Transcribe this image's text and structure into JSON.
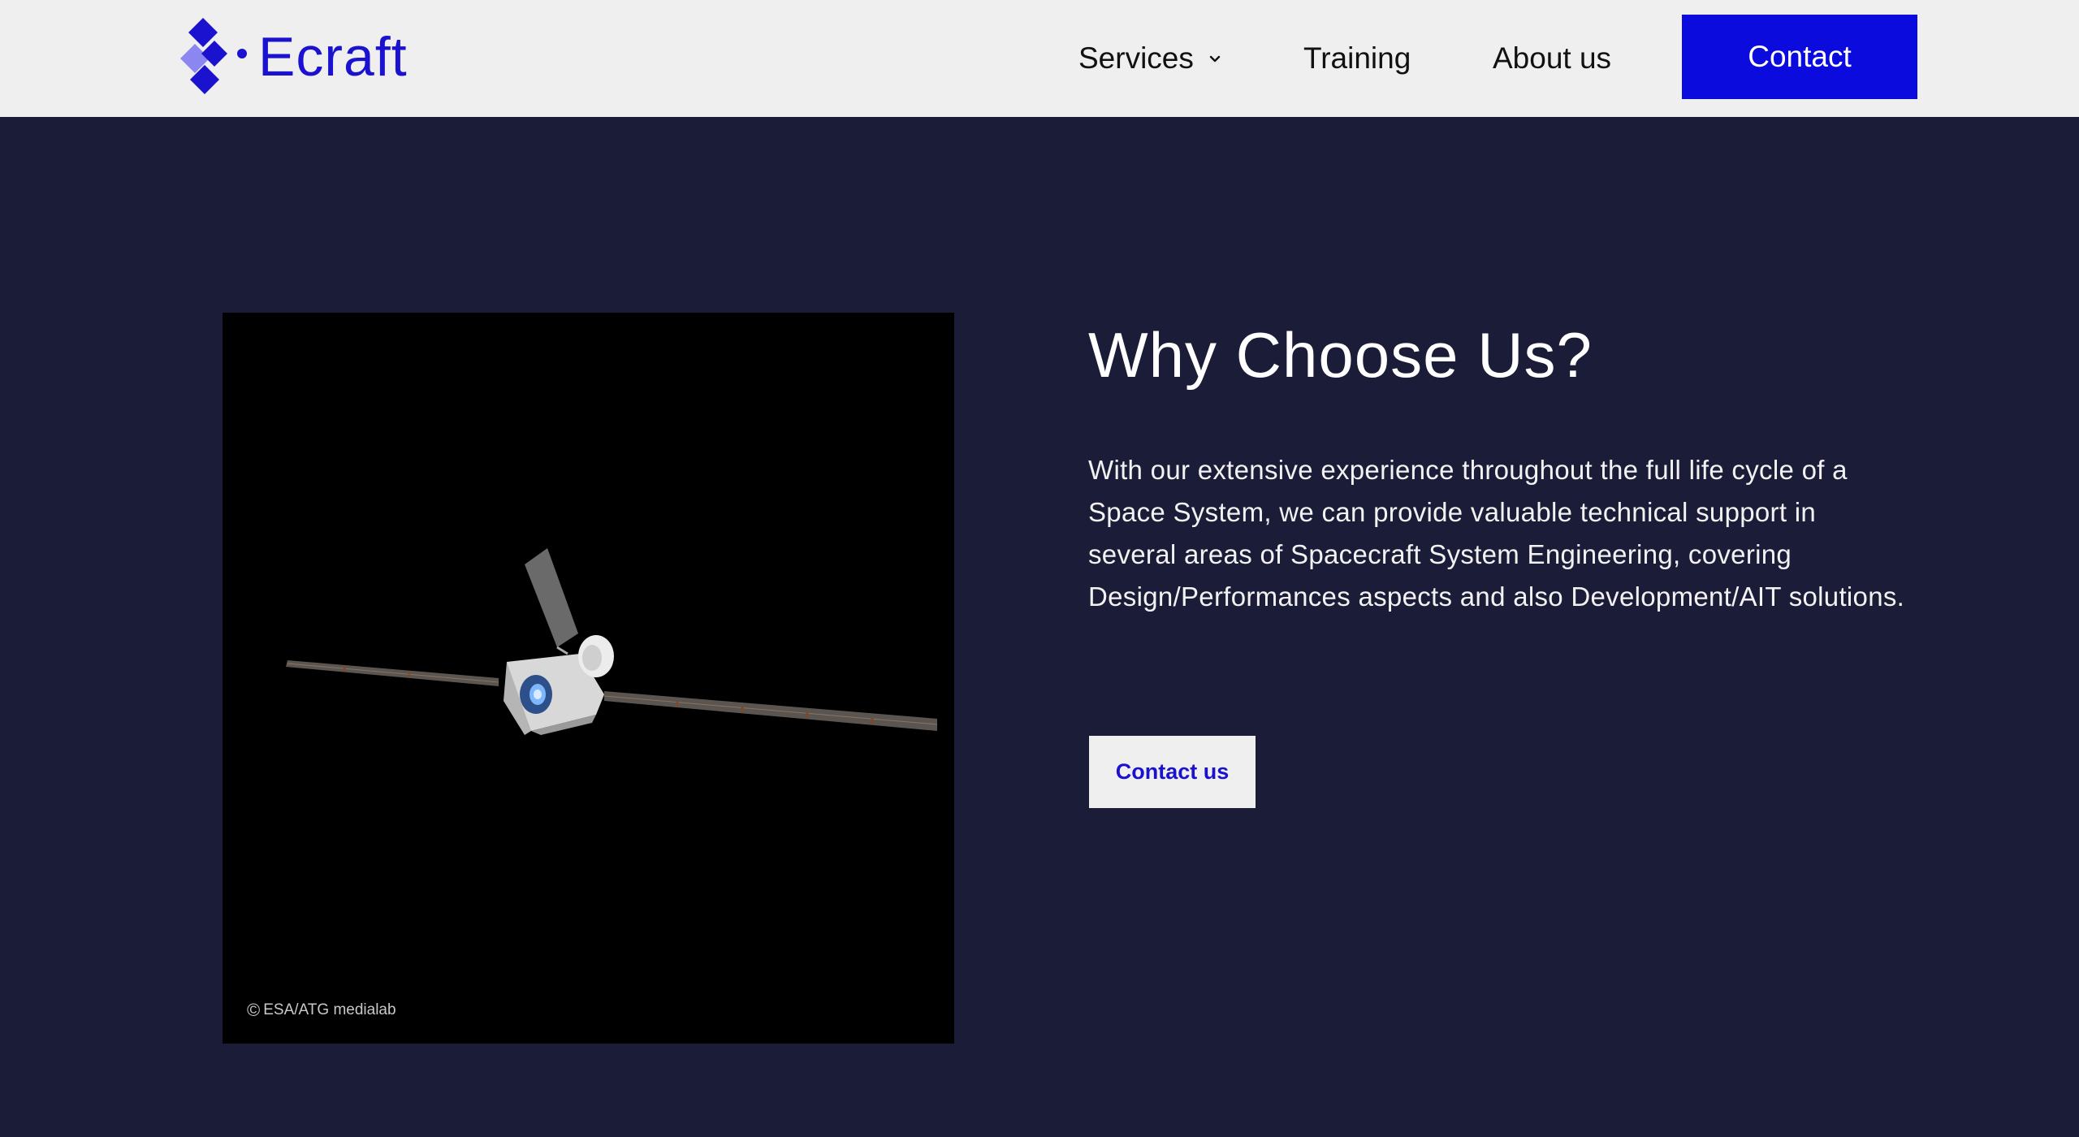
{
  "header": {
    "logo_text": "Ecraft",
    "logo_icon": "diamond-logo-icon",
    "nav": {
      "services": "Services",
      "training": "Training",
      "about": "About us"
    },
    "contact_label": "Contact"
  },
  "main": {
    "image_credit": "ESA/ATG medialab",
    "credit_icon": "copyright-icon",
    "title": "Why Choose Us?",
    "body": "With our extensive experience throughout the full life cycle of a Space System, we can provide valuable technical support in several areas of Spacecraft System Engineering, covering Design/Performances aspects and also Development/AIT solutions.",
    "cta_label": "Contact us"
  },
  "colors": {
    "header_bg": "#efefef",
    "page_bg": "#1b1c37",
    "brand_blue": "#0b0bdd",
    "logo_blue": "#1a12cf",
    "logo_light": "#8b86f0"
  }
}
